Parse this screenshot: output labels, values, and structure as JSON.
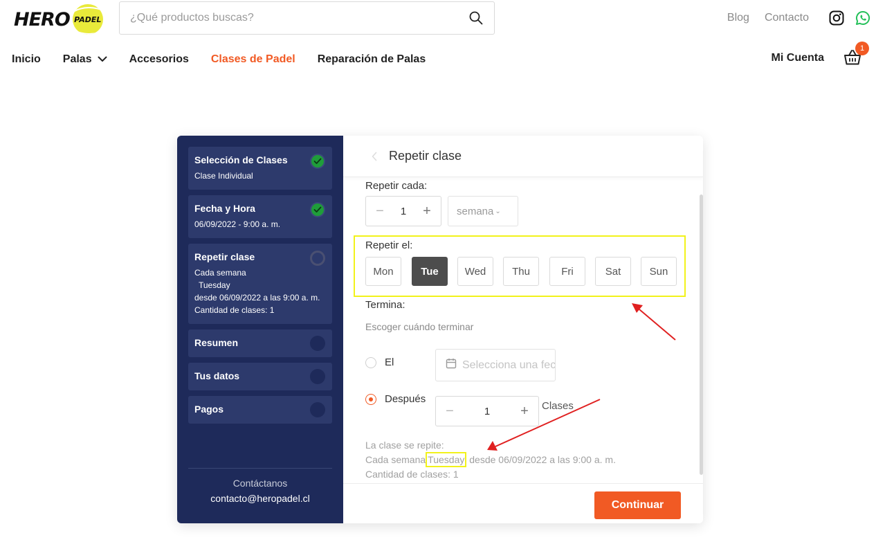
{
  "brand": {
    "name": "HERO",
    "ball_text": "PADEL"
  },
  "search": {
    "placeholder": "¿Qué productos buscas?"
  },
  "top_links": {
    "blog": "Blog",
    "contact": "Contacto"
  },
  "icons": {
    "search": "search-icon",
    "instagram": "instagram-icon",
    "whatsapp": "whatsapp-icon",
    "cart": "basket-icon",
    "chevron": "chevron-down-icon",
    "back": "chevron-left-icon",
    "calendar": "calendar-icon",
    "check": "check-icon"
  },
  "nav": {
    "items": [
      {
        "label": "Inicio"
      },
      {
        "label": "Palas"
      },
      {
        "label": "Accesorios"
      },
      {
        "label": "Clases de Padel"
      },
      {
        "label": "Reparación de Palas"
      }
    ],
    "active_index": 3,
    "account": "Mi Cuenta",
    "cart_count": "1"
  },
  "sidebar": {
    "steps": [
      {
        "title": "Selección de Clases",
        "lines": [
          "Clase Individual"
        ],
        "status": "done"
      },
      {
        "title": "Fecha y Hora",
        "lines": [
          "06/09/2022 - 9:00 a. m."
        ],
        "status": "done"
      },
      {
        "title": "Repetir clase",
        "lines": [
          "Cada semana",
          "Tuesday",
          "desde 06/09/2022 a las 9:00 a. m.",
          "Cantidad de clases: 1"
        ],
        "status": "current"
      },
      {
        "title": "Resumen",
        "status": "pending"
      },
      {
        "title": "Tus datos",
        "status": "pending"
      },
      {
        "title": "Pagos",
        "status": "pending"
      }
    ],
    "contact_label": "Contáctanos",
    "contact_email": "contacto@heropadel.cl"
  },
  "main": {
    "title": "Repetir clase",
    "repeat_every_label": "Repetir cada:",
    "repeat_every_value": "1",
    "repeat_every_unit": "semana",
    "repeat_on_label": "Repetir el:",
    "days": [
      "Mon",
      "Tue",
      "Wed",
      "Thu",
      "Fri",
      "Sat",
      "Sun"
    ],
    "selected_day": "Tue",
    "ends_label": "Termina:",
    "ends_hint": "Escoger cuándo terminar",
    "option_on": "El",
    "date_placeholder": "Selecciona una fecha",
    "option_after": "Después",
    "after_value": "1",
    "after_unit": "Clases",
    "summary_title": "La clase se repite:",
    "summary_prefix": "Cada semana",
    "summary_day": "Tuesday",
    "summary_suffix": "desde 06/09/2022 a las 9:00 a. m.",
    "summary_count": "Cantidad de clases: 1",
    "continue": "Continuar"
  },
  "colors": {
    "accent": "#f15a24",
    "sidebar_bg": "#1e2a5a",
    "sidebar_card": "#2d3a6c",
    "done_green": "#1f9d3a",
    "annotation_yellow": "#f2f21a",
    "annotation_red": "#e02020"
  }
}
